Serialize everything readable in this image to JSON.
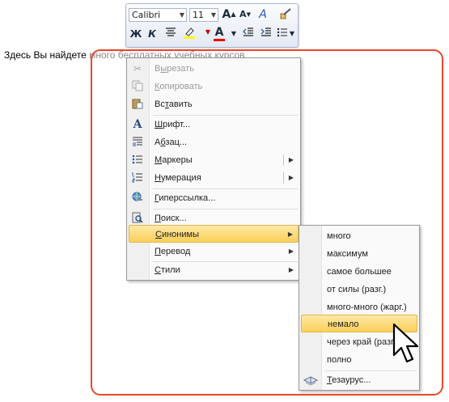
{
  "mini_toolbar": {
    "font_name": "Calibri",
    "font_size": "11",
    "grow_font_icon": "grow-font-icon",
    "shrink_font_icon": "shrink-font-icon",
    "styles_icon": "styles-icon",
    "format_painter_icon": "format-painter-icon",
    "bold_label": "Ж",
    "italic_label": "К",
    "center_icon": "align-center-icon",
    "highlight_icon": "highlight-icon",
    "font_color_label": "A",
    "decrease_indent_icon": "decrease-indent-icon",
    "increase_indent_icon": "increase-indent-icon",
    "bullets_icon": "bullets-icon"
  },
  "document": {
    "text_before": "Здесь Вы найдете ",
    "text_faded": "много бесплатных учебных курсов"
  },
  "context_menu": {
    "items": [
      {
        "label": "Вырезать",
        "ul": "ы",
        "icon": "scissors-icon"
      },
      {
        "label": "Копировать",
        "ul": "К",
        "icon": "copy-icon"
      },
      {
        "label": "Вставить",
        "ul": "т",
        "icon": "paste-icon"
      },
      {
        "label": "Шрифт...",
        "ul": "Ш",
        "icon": "font-icon"
      },
      {
        "label": "Абзац...",
        "ul": "б",
        "icon": "paragraph-icon"
      },
      {
        "label": "Маркеры",
        "ul": "М",
        "icon": "bullets-icon"
      },
      {
        "label": "Нумерация",
        "ul": "Н",
        "icon": "numbering-icon"
      },
      {
        "label": "Гиперссылка...",
        "ul": "Г",
        "icon": "hyperlink-icon"
      },
      {
        "label": "Поиск...",
        "ul": "П",
        "icon": "research-icon"
      },
      {
        "label": "Синонимы",
        "ul": "С",
        "icon": ""
      },
      {
        "label": "Перевод",
        "ul": "П",
        "icon": ""
      },
      {
        "label": "Стили",
        "ul": "С",
        "icon": ""
      }
    ]
  },
  "synonyms_menu": {
    "items": [
      "много",
      "максимум",
      "самое большее",
      "от силы (разг.)",
      "много-много (жарг.)",
      "немало",
      "через край (разг.)",
      "полно"
    ],
    "thesaurus_label": "Тезаурус...",
    "thesaurus_icon": "thesaurus-icon"
  },
  "colors": {
    "highlight_frame": "#e8472b",
    "menu_hover": "#fbcf58"
  }
}
